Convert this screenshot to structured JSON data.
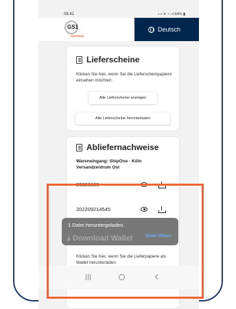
{
  "status_bar": {
    "time": "08:41",
    "battery_text": "94%"
  },
  "app_bar": {
    "logo_text": "GS1",
    "logo_subtext": "Germany",
    "language_label": "Deutsch"
  },
  "delivery_notes": {
    "title": "Lieferscheine",
    "description": "Klicken Sie hier, wenn Sie die Lieferscheinpapiere einsehen möchten.",
    "show_all_label": "Alle Lieferscheine anzeigen",
    "download_all_label": "Alle Lieferscheine herunterladen"
  },
  "delivery_proofs": {
    "title": "Abliefernachweise",
    "subtitle": "Wareneingang: ShipOne - Köln Versandzentrum Ost",
    "rows": [
      {
        "id": "20220925"
      },
      {
        "id": "202209214545"
      }
    ],
    "wallet_title": "Download Wallet",
    "wallet_description": "Klicken Sie hier, wenn Sie die Lieferpapiere als Wallet herunterladen"
  },
  "toast": {
    "message": "1 Datei heruntergeladen.",
    "action_label": "Datei öffnen"
  },
  "colors": {
    "brand_navy": "#00264d",
    "brand_orange": "#f26334",
    "highlight": "#f26334",
    "frame": "#1d3a6b"
  }
}
